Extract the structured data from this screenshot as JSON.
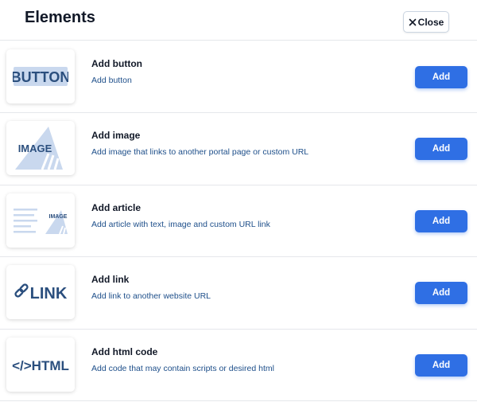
{
  "header": {
    "title": "Elements",
    "close_label": "Close"
  },
  "items": [
    {
      "title": "Add button",
      "description": "Add button",
      "thumb_text": "BUTTON",
      "thumb_icon": "button-thumbnail-icon",
      "add_label": "Add"
    },
    {
      "title": "Add image",
      "description": "Add image that links to another portal page or custom URL",
      "thumb_text": "IMAGE",
      "thumb_icon": "image-thumbnail-icon",
      "add_label": "Add"
    },
    {
      "title": "Add article",
      "description": "Add article with text, image and custom URL link",
      "thumb_text": "IMAGE",
      "thumb_icon": "article-thumbnail-icon",
      "add_label": "Add"
    },
    {
      "title": "Add link",
      "description": "Add link to another website URL",
      "thumb_text": "LINK",
      "thumb_icon": "link-thumbnail-icon",
      "add_label": "Add"
    },
    {
      "title": "Add html code",
      "description": "Add code that may contain scripts or desired html",
      "thumb_text": "</>HTML",
      "thumb_icon": "html-thumbnail-icon",
      "add_label": "Add"
    }
  ],
  "colors": {
    "accent": "#2f6fe4",
    "thumb_text": "#2b4f7e",
    "thumb_light": "#c9d8ee",
    "description": "#1e4f8a"
  }
}
